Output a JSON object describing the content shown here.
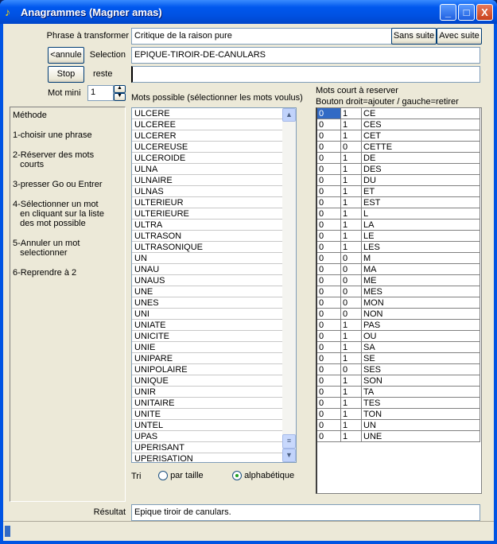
{
  "window": {
    "title": "Anagrammes  (Magner amas)",
    "minimize": "_",
    "maximize": "□",
    "close": "X"
  },
  "phrase": {
    "label": "Phrase à transformer",
    "value": "Critique de la raison pure",
    "sans_suite": "Sans suite",
    "avec_suite": "Avec suite"
  },
  "selection": {
    "annule": "<annule",
    "label": "Selection",
    "value": "EPIQUE-TIROIR-DE-CANULARS"
  },
  "reste": {
    "stop": "Stop",
    "label": "reste",
    "value": ""
  },
  "mot_mini": {
    "label": "Mot mini",
    "value": "1"
  },
  "method": {
    "items": [
      "Méthode",
      "1-choisir une phrase",
      "2-Réserver des mots\n   courts",
      "3-presser Go ou Entrer",
      "4-Sélectionner un mot\n   en cliquant sur la liste\n   des mot possible",
      "5-Annuler un mot\n   selectionner",
      "6-Reprendre à 2"
    ]
  },
  "possible": {
    "label": "Mots possible (sélectionner les mots voulus)",
    "items": [
      "ULCERE",
      "ULCEREE",
      "ULCERER",
      "ULCEREUSE",
      "ULCEROIDE",
      "ULNA",
      "ULNAIRE",
      "ULNAS",
      "ULTERIEUR",
      "ULTERIEURE",
      "ULTRA",
      "ULTRASON",
      "ULTRASONIQUE",
      "UN",
      "UNAU",
      "UNAUS",
      "UNE",
      "UNES",
      "UNI",
      "UNIATE",
      "UNICITE",
      "UNIE",
      "UNIPARE",
      "UNIPOLAIRE",
      "UNIQUE",
      "UNIR",
      "UNITAIRE",
      "UNITE",
      "UNTEL",
      "UPAS",
      "UPERISANT",
      "UPERISATION"
    ]
  },
  "tri": {
    "label": "Tri",
    "options": [
      {
        "label": "par taille",
        "selected": false
      },
      {
        "label": "alphabétique",
        "selected": true
      }
    ]
  },
  "reserve": {
    "label1": "Mots court à reserver",
    "label2": "Bouton droit=ajouter / gauche=retirer",
    "rows": [
      [
        "0",
        "1",
        "CE"
      ],
      [
        "0",
        "1",
        "CES"
      ],
      [
        "0",
        "1",
        "CET"
      ],
      [
        "0",
        "0",
        "CETTE"
      ],
      [
        "0",
        "1",
        "DE"
      ],
      [
        "0",
        "1",
        "DES"
      ],
      [
        "0",
        "1",
        "DU"
      ],
      [
        "0",
        "1",
        "ET"
      ],
      [
        "0",
        "1",
        "EST"
      ],
      [
        "0",
        "1",
        "L"
      ],
      [
        "0",
        "1",
        "LA"
      ],
      [
        "0",
        "1",
        "LE"
      ],
      [
        "0",
        "1",
        "LES"
      ],
      [
        "0",
        "0",
        "M"
      ],
      [
        "0",
        "0",
        "MA"
      ],
      [
        "0",
        "0",
        "ME"
      ],
      [
        "0",
        "0",
        "MES"
      ],
      [
        "0",
        "0",
        "MON"
      ],
      [
        "0",
        "0",
        "NON"
      ],
      [
        "0",
        "1",
        "PAS"
      ],
      [
        "0",
        "1",
        "OU"
      ],
      [
        "0",
        "1",
        "SA"
      ],
      [
        "0",
        "1",
        "SE"
      ],
      [
        "0",
        "0",
        "SES"
      ],
      [
        "0",
        "1",
        "SON"
      ],
      [
        "0",
        "1",
        "TA"
      ],
      [
        "0",
        "1",
        "TES"
      ],
      [
        "0",
        "1",
        "TON"
      ],
      [
        "0",
        "1",
        "UN"
      ],
      [
        "0",
        "1",
        "UNE"
      ]
    ]
  },
  "resultat": {
    "label": "Résultat",
    "value": "Epique tiroir de canulars."
  },
  "status": {
    "progress_percent": 1
  },
  "colors": {
    "title_bar": "#0054e3",
    "selected_cell": "#316ac5",
    "face": "#ece9d8"
  }
}
